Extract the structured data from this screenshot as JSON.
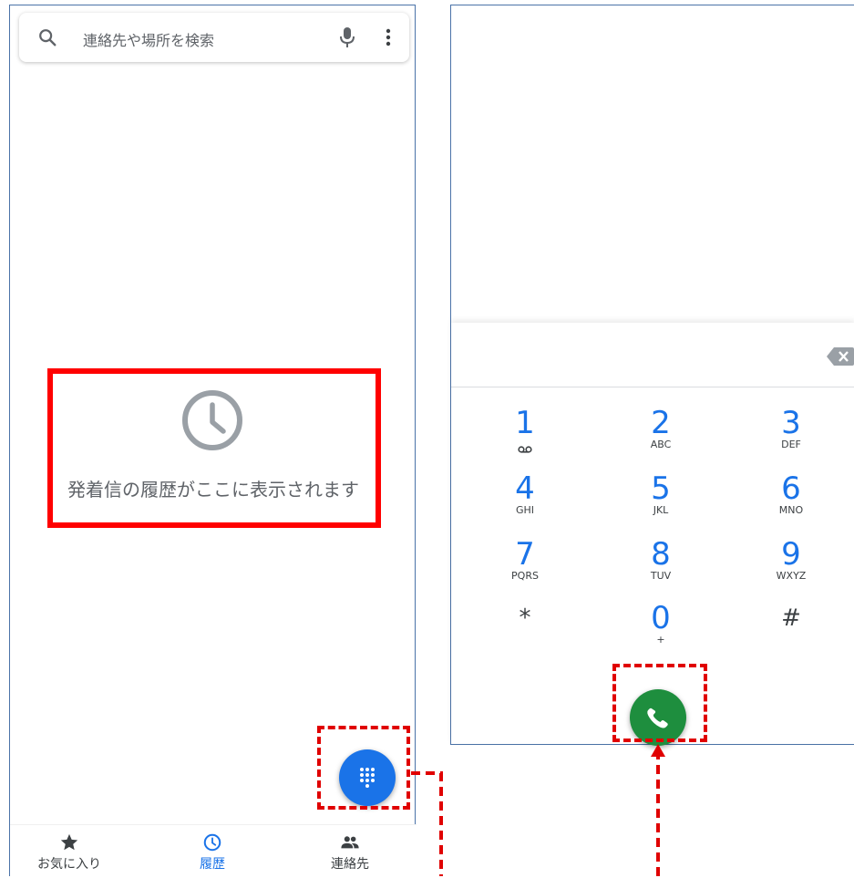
{
  "search": {
    "placeholder": "連絡先や場所を検索"
  },
  "empty_state": {
    "message": "発着信の履歴がここに表示されます"
  },
  "bottom_nav": [
    {
      "label": "お気に入り",
      "icon": "star-icon",
      "active": false
    },
    {
      "label": "履歴",
      "icon": "clock-icon",
      "active": true
    },
    {
      "label": "連絡先",
      "icon": "people-icon",
      "active": false
    }
  ],
  "dialpad": {
    "keys": [
      {
        "digit": "1",
        "letters": "",
        "voicemail": true
      },
      {
        "digit": "2",
        "letters": "ABC"
      },
      {
        "digit": "3",
        "letters": "DEF"
      },
      {
        "digit": "4",
        "letters": "GHI"
      },
      {
        "digit": "5",
        "letters": "JKL"
      },
      {
        "digit": "6",
        "letters": "MNO"
      },
      {
        "digit": "7",
        "letters": "PQRS"
      },
      {
        "digit": "8",
        "letters": "TUV"
      },
      {
        "digit": "9",
        "letters": "WXYZ"
      },
      {
        "digit": "*",
        "letters": ""
      },
      {
        "digit": "0",
        "letters": "+"
      },
      {
        "digit": "#",
        "letters": ""
      }
    ]
  },
  "colors": {
    "accent": "#1a73e8",
    "call": "#1e8e3e",
    "annotation": "#ff0000"
  }
}
